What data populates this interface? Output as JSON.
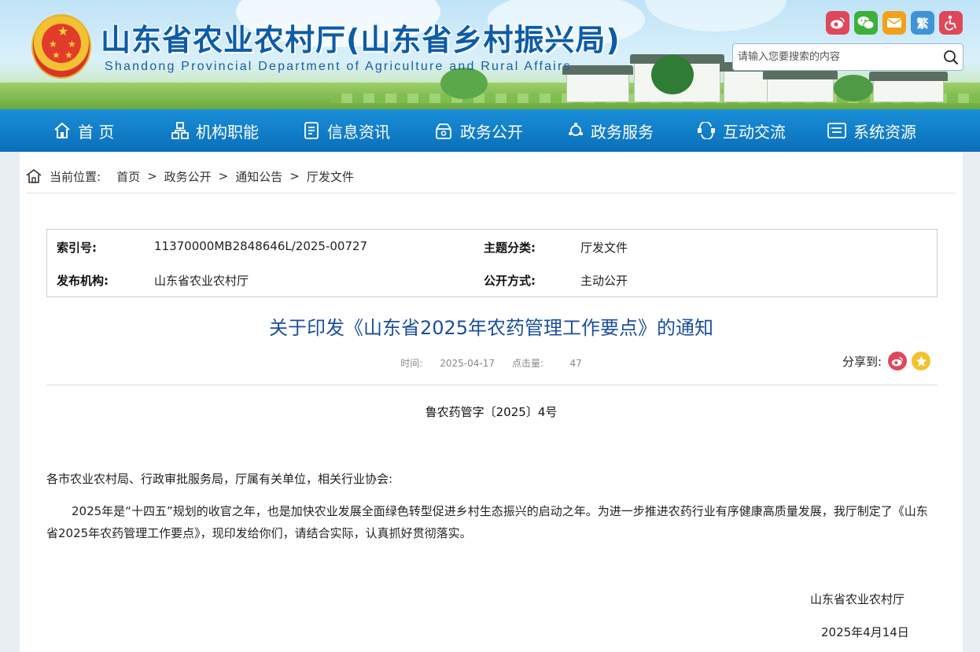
{
  "header": {
    "title": "山东省农业农村厅(山东省乡村振兴局)",
    "subtitle": "Shandong Provincial Department of Agriculture and Rural Affairs",
    "fanti_label": "繁",
    "top_icons": [
      {
        "name": "weibo-icon",
        "color": "#e0475a"
      },
      {
        "name": "wechat-icon",
        "color": "#3db03a"
      },
      {
        "name": "mail-icon",
        "color": "#f3a01b"
      },
      {
        "name": "traditional-chinese-icon",
        "color": "#3f93d6"
      },
      {
        "name": "accessibility-icon",
        "color": "#e0475a"
      }
    ],
    "search": {
      "placeholder": "请输入您要搜索的内容",
      "value": ""
    }
  },
  "nav": {
    "items": [
      {
        "label": "首 页",
        "icon": "home-icon"
      },
      {
        "label": "机构职能",
        "icon": "org-chart-icon"
      },
      {
        "label": "信息资讯",
        "icon": "document-list-icon"
      },
      {
        "label": "政务公开",
        "icon": "box-open-icon"
      },
      {
        "label": "政务服务",
        "icon": "service-icon"
      },
      {
        "label": "互动交流",
        "icon": "interaction-icon"
      },
      {
        "label": "系统资源",
        "icon": "system-resource-icon"
      }
    ]
  },
  "breadcrumb": {
    "prefix": "当前位置:",
    "items": [
      "首页",
      "政务公开",
      "通知公告",
      "厅发文件"
    ],
    "separator": ">"
  },
  "meta": {
    "index_key": "索引号:",
    "index_val": "11370000MB2848646L/2025-00727",
    "topic_key": "主题分类:",
    "topic_val": "厅发文件",
    "publisher_key": "发布机构:",
    "publisher_val": "山东省农业农村厅",
    "mode_key": "公开方式:",
    "mode_val": "主动公开"
  },
  "article": {
    "title": "关于印发《山东省2025年农药管理工作要点》的通知",
    "time_label": "时间:",
    "time_value": "2025-04-17",
    "hits_label": "点击量:",
    "hits_value": "47",
    "share_label": "分享到:",
    "doc_number": "鲁农药管字〔2025〕4号",
    "salutation": "各市农业农村局、行政审批服务局，厅属有关单位，相关行业协会:",
    "body": "2025年是“十四五”规划的收官之年，也是加快农业发展全面绿色转型促进乡村生态振兴的启动之年。为进一步推进农药行业有序健康高质量发展，我厅制定了《山东省2025年农药管理工作要点》，现印发给你们，请结合实际，认真抓好贯彻落实。",
    "signer": "山东省农业农村厅",
    "date": "2025年4月14日"
  },
  "colors": {
    "nav_bg": "#0b6fba",
    "title_blue": "#1b4f9c",
    "brand_blue": "#0d5ca8"
  }
}
